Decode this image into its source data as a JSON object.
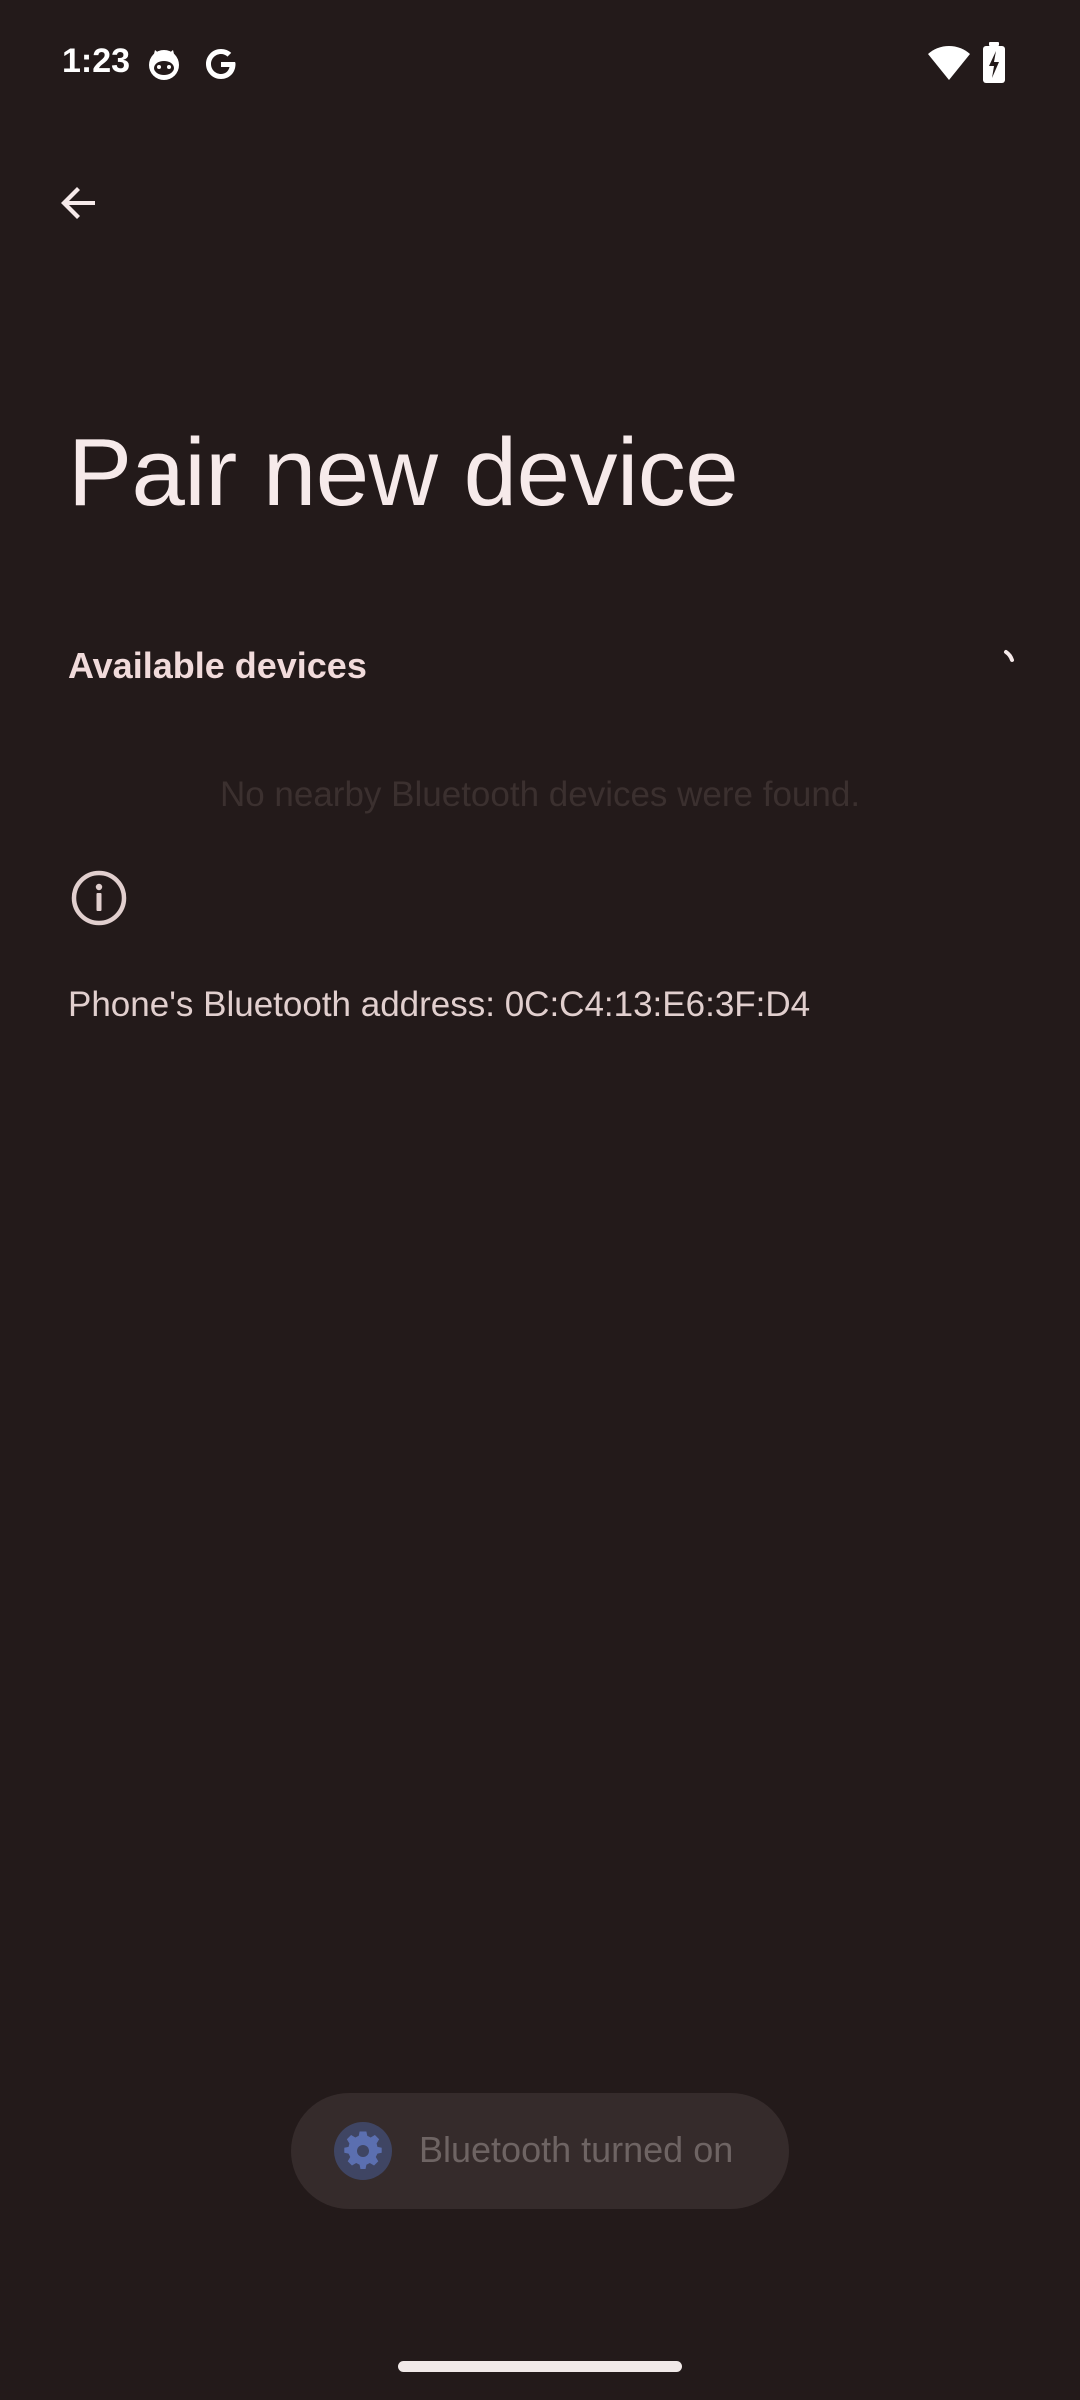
{
  "status_bar": {
    "time": "1:23",
    "icons": [
      "cat-notification-icon",
      "google-icon",
      "wifi-icon",
      "battery-charging-icon"
    ]
  },
  "toolbar": {
    "back_icon": "arrow-back-icon"
  },
  "page": {
    "title": "Pair new device"
  },
  "available_devices": {
    "header": "Available devices",
    "empty_message": "No nearby Bluetooth devices were found.",
    "loading_icon": "progress-spinner-icon"
  },
  "info": {
    "icon": "info-icon",
    "address_text": "Phone's Bluetooth address: 0C:C4:13:E6:3F:D4"
  },
  "toast": {
    "icon": "settings-gear-icon",
    "message": "Bluetooth turned on"
  },
  "colors": {
    "background": "#231a1a",
    "title_text": "#f6eaea",
    "toast_background": "#352b2b",
    "toast_icon": "#4b5a8a"
  }
}
